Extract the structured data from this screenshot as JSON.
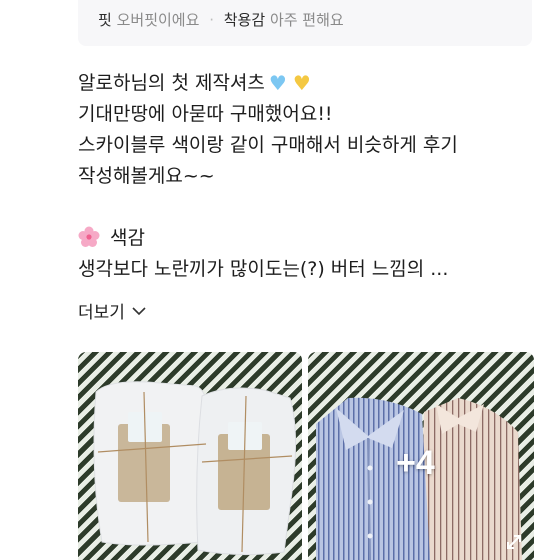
{
  "options": {
    "fit_label": "핏",
    "fit_value": "오버핏이에요",
    "separator": "·",
    "wear_label": "착용감",
    "wear_value": "아주 편해요"
  },
  "review": {
    "lines": [
      "알로하님의 첫 제작셔츠",
      "기대만땅에 아묻따 구매했어요!!",
      "스카이블루 색이랑 같이 구매해서 비슷하게 후기",
      "작성해볼게요~~"
    ],
    "section_title": "색감",
    "section_line": "생각보다 노란끼가 많이도는(?) 버터 느낌의 ..."
  },
  "more_label": "더보기",
  "photos": {
    "extra_count_label": "+4"
  },
  "icons": {
    "hearts": [
      "blue-heart-icon",
      "yellow-heart-icon"
    ],
    "section": "cherry-blossom-icon",
    "more": "chevron-down-icon",
    "expand": "expand-icon"
  }
}
